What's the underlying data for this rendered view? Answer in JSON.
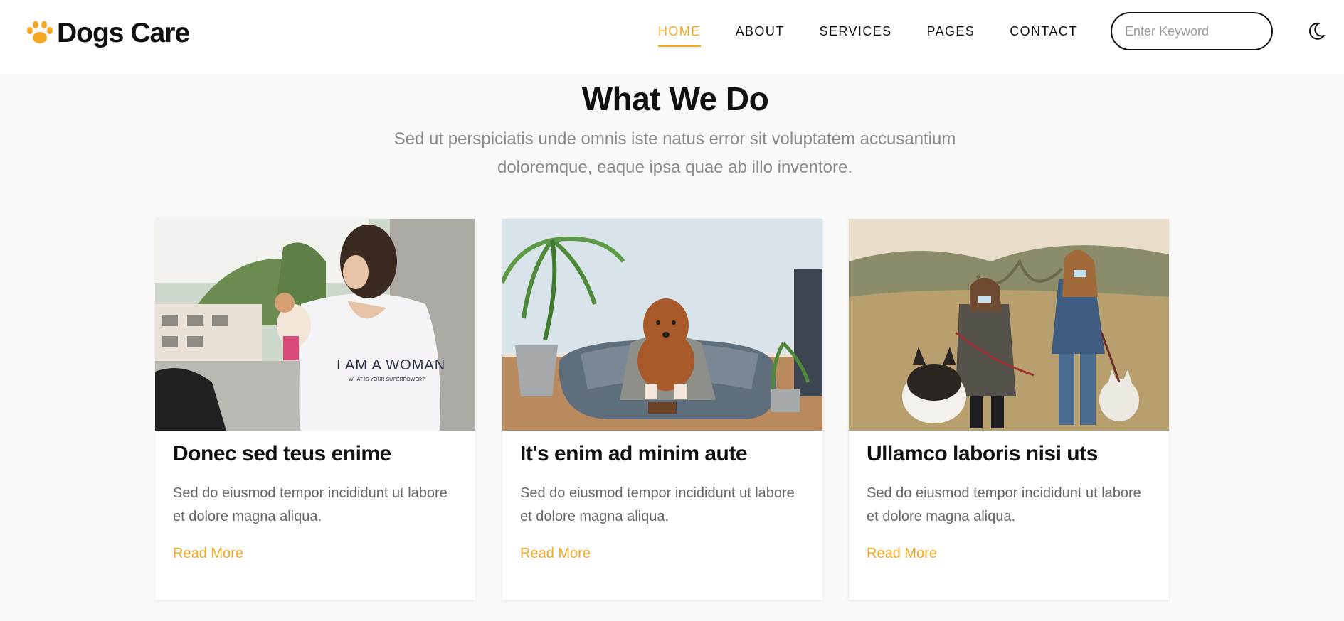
{
  "brand": {
    "name": "Dogs Care",
    "icon": "paw-icon",
    "accent_color": "#f5a623"
  },
  "nav": {
    "items": [
      {
        "label": "HOME",
        "active": true
      },
      {
        "label": "ABOUT",
        "active": false
      },
      {
        "label": "SERVICES",
        "active": false
      },
      {
        "label": "PAGES",
        "active": false
      },
      {
        "label": "CONTACT",
        "active": false
      }
    ]
  },
  "search": {
    "placeholder": "Enter Keyword",
    "value": ""
  },
  "theme_toggle": {
    "icon": "moon-icon"
  },
  "section": {
    "title": "What We Do",
    "subtitle": "Sed ut perspiciatis unde omnis iste natus error sit voluptatem accusantium doloremque, eaque ipsa quae ab illo inventore."
  },
  "cards": [
    {
      "title": "Donec sed teus enime",
      "text": "Sed do eiusmod tempor incididunt ut labore et dolore magna aliqua.",
      "link": "Read More"
    },
    {
      "title": "It's enim ad minim aute",
      "text": "Sed do eiusmod tempor incididunt ut labore et dolore magna aliqua.",
      "link": "Read More"
    },
    {
      "title": "Ullamco laboris nisi uts",
      "text": "Sed do eiusmod tempor incididunt ut labore et dolore magna aliqua.",
      "link": "Read More"
    }
  ]
}
